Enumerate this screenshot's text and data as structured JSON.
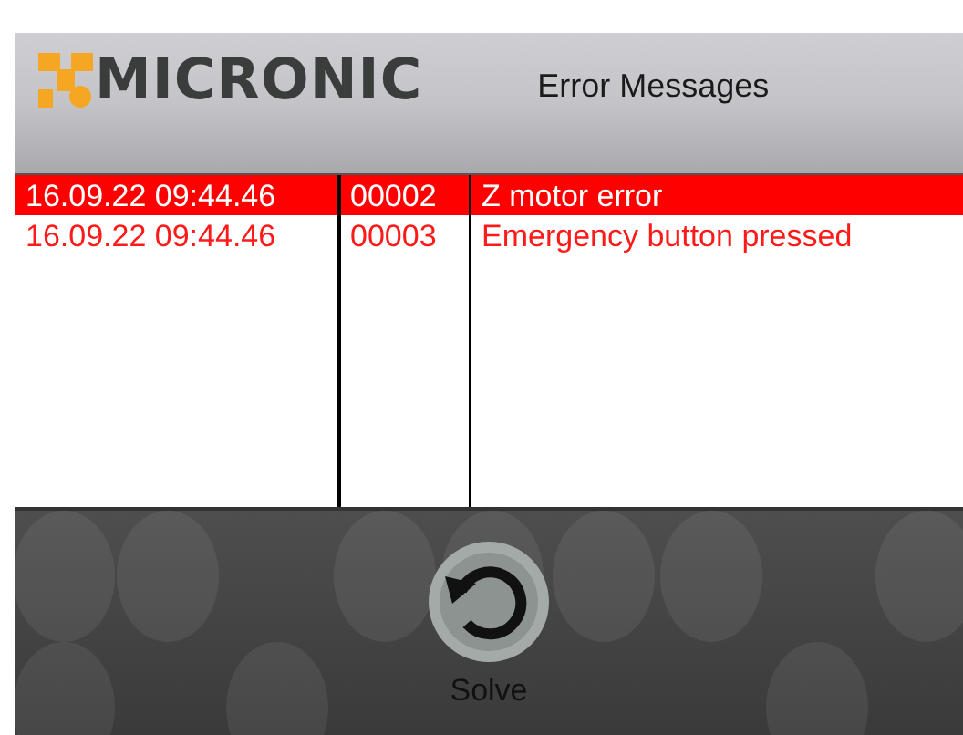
{
  "header": {
    "logo": "MICRONIC",
    "title": "Error Messages"
  },
  "table": {
    "rows": [
      {
        "time": "16.09.22 09:44.46",
        "code": "00002",
        "message": "Z motor error",
        "selected": true
      },
      {
        "time": "16.09.22 09:44.46",
        "code": "00003",
        "message": "Emergency button pressed",
        "selected": false
      }
    ]
  },
  "toolbar": {
    "buttons": [
      {
        "kind": "solve",
        "label": "Solve"
      }
    ]
  }
}
